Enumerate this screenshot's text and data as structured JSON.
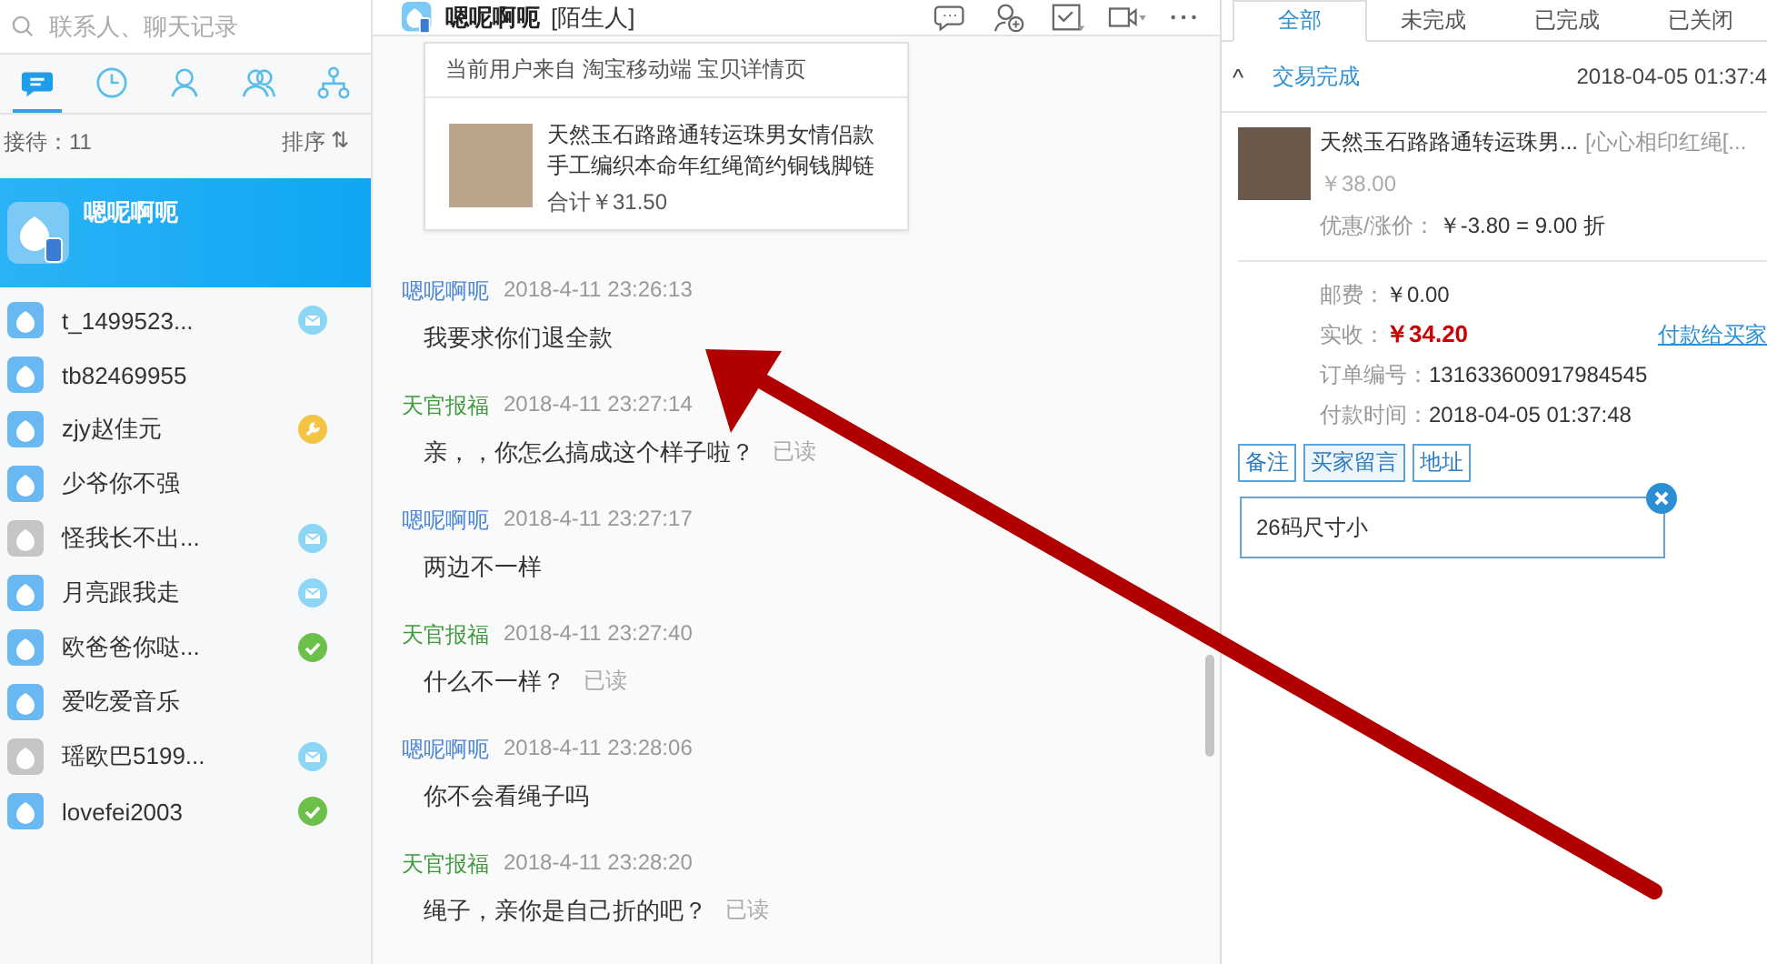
{
  "sidebar": {
    "search": {
      "placeholder": "联系人、聊天记录"
    },
    "tabs": [
      {
        "selected": true
      },
      {
        "selected": false
      },
      {
        "selected": false
      },
      {
        "selected": false
      },
      {
        "selected": false
      }
    ],
    "reception_count": "接待：11",
    "sort_label": "排序",
    "sort_icon": "⇅",
    "active_contact": {
      "name": "嗯呢啊呃",
      "selected": true
    },
    "contacts": [
      {
        "name": "t_1499523...",
        "online": true,
        "kind": "mail"
      },
      {
        "name": "tb82469955",
        "online": true,
        "kind": "plain"
      },
      {
        "name": "zjy赵佳元",
        "online": true,
        "kind": "key"
      },
      {
        "name": "少爷你不强",
        "online": true,
        "kind": "plain"
      },
      {
        "name": "怪我长不出...",
        "online": false,
        "kind": "mail"
      },
      {
        "name": "月亮跟我走",
        "online": true,
        "kind": "mail"
      },
      {
        "name": "欧爸爸你哒...",
        "online": true,
        "kind": "check"
      },
      {
        "name": "爱吃爱音乐",
        "online": true,
        "kind": "plain"
      },
      {
        "name": "瑶欧巴5199...",
        "online": false,
        "kind": "mail"
      },
      {
        "name": "lovefei2003",
        "online": true,
        "kind": "check"
      }
    ]
  },
  "chat": {
    "title": "嗯呢啊呃",
    "tag": "[陌生人]",
    "source_card": {
      "source": "当前用户来自 淘宝移动端 宝贝详情页",
      "product": "天然玉石路路通转运珠男女情侣款手工编织本命年红绳简约铜钱脚链",
      "total": "合计￥31.50"
    },
    "messages": [
      {
        "sender": "嗯呢啊呃",
        "color": "#4a86d8",
        "time": "2018-4-11 23:26:13",
        "text": "我要求你们退全款"
      },
      {
        "sender": "天官报福",
        "color": "#3d9a3d",
        "time": "2018-4-11 23:27:14",
        "text": "亲，，你怎么搞成这个样子啦？",
        "status": "已读"
      },
      {
        "sender": "嗯呢啊呃",
        "color": "#4a86d8",
        "time": "2018-4-11 23:27:17",
        "text": "两边不一样"
      },
      {
        "sender": "天官报福",
        "color": "#3d9a3d",
        "time": "2018-4-11 23:27:40",
        "text": "什么不一样？",
        "status": "已读"
      },
      {
        "sender": "嗯呢啊呃",
        "color": "#4a86d8",
        "time": "2018-4-11 23:28:06",
        "text": "你不会看绳子吗"
      },
      {
        "sender": "天官报福",
        "color": "#3d9a3d",
        "time": "2018-4-11 23:28:20",
        "text": "绳子，亲你是自己折的吧？",
        "status": "已读"
      }
    ]
  },
  "orders": {
    "tabs": [
      {
        "label": "全部",
        "selected": true
      },
      {
        "label": "未完成",
        "selected": false
      },
      {
        "label": "已完成",
        "selected": false
      },
      {
        "label": "已关闭",
        "selected": false
      }
    ],
    "order": {
      "caret": "^",
      "status": "交易完成",
      "expanded": true,
      "time": "2018-04-05 01:37:4",
      "product": "天然玉石路路通转运珠男...",
      "sku": "[心心相印红绳[...",
      "price": "￥38.00",
      "discount_label": "优惠/涨价：",
      "discount": "￥-3.80 = 9.00 折",
      "fields": [
        {
          "label": "邮费：",
          "value": "￥0.00",
          "kind": "plain"
        },
        {
          "label": "实收：",
          "value": "￥34.20",
          "kind": "amount",
          "link": "付款给买家"
        },
        {
          "label": "订单编号：",
          "value": "131633600917984545",
          "kind": "plain"
        },
        {
          "label": "付款时间：",
          "value": "2018-04-05 01:37:48",
          "kind": "plain"
        }
      ],
      "note_tabs": [
        {
          "label": "备注",
          "selected": false
        },
        {
          "label": "买家留言",
          "selected": true
        },
        {
          "label": "地址",
          "selected": false
        }
      ],
      "note_text": "26码尺寸小"
    }
  }
}
